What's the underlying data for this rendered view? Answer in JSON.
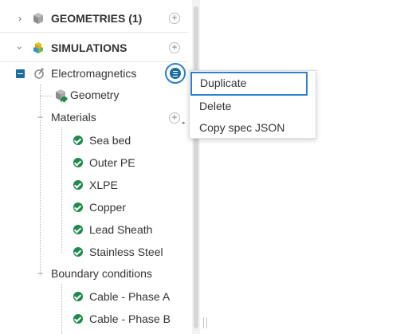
{
  "tree": {
    "geometries": {
      "label": "GEOMETRIES (1)"
    },
    "simulations": {
      "label": "SIMULATIONS"
    },
    "simulation": {
      "label": "Electromagnetics",
      "geometry_label": "Geometry",
      "materials": {
        "label": "Materials",
        "items": [
          "Sea bed",
          "Outer PE",
          "XLPE",
          "Copper",
          "Lead Sheath",
          "Stainless Steel"
        ]
      },
      "boundary_conditions": {
        "label": "Boundary conditions",
        "items": [
          "Cable - Phase A",
          "Cable - Phase B"
        ]
      }
    }
  },
  "context_menu": {
    "items": [
      "Duplicate",
      "Delete",
      "Copy spec JSON"
    ],
    "highlighted": "Duplicate"
  },
  "icons": {
    "expand": "chevron-right-icon",
    "collapse": "chevron-down-icon",
    "add": "plus-circle-icon",
    "geometry": "cube-icon",
    "simulation_group": "colored-cubes-icon",
    "simulation": "electromagnetics-icon",
    "status": "check-circle-icon",
    "menu": "menu-icon"
  },
  "colors": {
    "accent": "#1b6d9e",
    "highlight": "#2f7ec8",
    "check": "#1f8a4c"
  }
}
